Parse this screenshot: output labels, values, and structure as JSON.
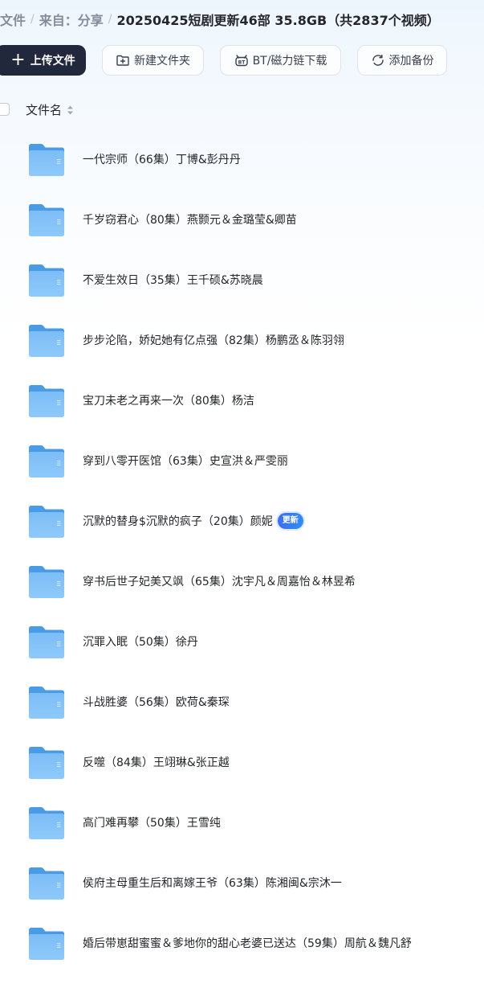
{
  "breadcrumb": {
    "items": [
      "文件",
      "来自：分享",
      "20250425短剧更新46部 35.8GB（共2837个视频）"
    ],
    "separator": "/"
  },
  "toolbar": {
    "upload_label": "上传文件",
    "new_folder_label": "新建文件夹",
    "bt_download_label": "BT/磁力链下载",
    "add_backup_label": "添加备份"
  },
  "table_header": {
    "name_column": "文件名"
  },
  "files": [
    {
      "name": "一代宗师（66集）丁博&彭丹丹",
      "badge": ""
    },
    {
      "name": "千岁窃君心（80集）燕颢元＆金璐莹&卿苗",
      "badge": ""
    },
    {
      "name": "不爱生效日（35集）王千硕&苏晓晨",
      "badge": ""
    },
    {
      "name": "步步沦陷，娇妃她有亿点强（82集）杨鹏丞＆陈羽翎",
      "badge": ""
    },
    {
      "name": "宝刀未老之再来一次（80集）杨洁",
      "badge": ""
    },
    {
      "name": "穿到八零开医馆（63集）史宣洪＆严雯丽",
      "badge": ""
    },
    {
      "name": "沉默的替身$沉默的疯子（20集）颜妮",
      "badge": "更新"
    },
    {
      "name": "穿书后世子妃美又飒（65集）沈宇凡＆周嘉怡＆林昱希",
      "badge": ""
    },
    {
      "name": "沉罪入眠（50集）徐丹",
      "badge": ""
    },
    {
      "name": "斗战胜婆（56集）欧荷&秦琛",
      "badge": ""
    },
    {
      "name": "反噬（84集）王翊琳&张正越",
      "badge": ""
    },
    {
      "name": "高门难再攀（50集）王雪纯",
      "badge": ""
    },
    {
      "name": "侯府主母重生后和离嫁王爷（63集）陈湘闽&宗沐一",
      "badge": ""
    },
    {
      "name": "婚后带崽甜蜜蜜＆爹地你的甜心老婆已送达（59集）周航＆魏凡舒",
      "badge": ""
    }
  ],
  "colors": {
    "primary_button": "#21283b",
    "folder": "#5aa8ee",
    "badge": "#3d6df5"
  }
}
